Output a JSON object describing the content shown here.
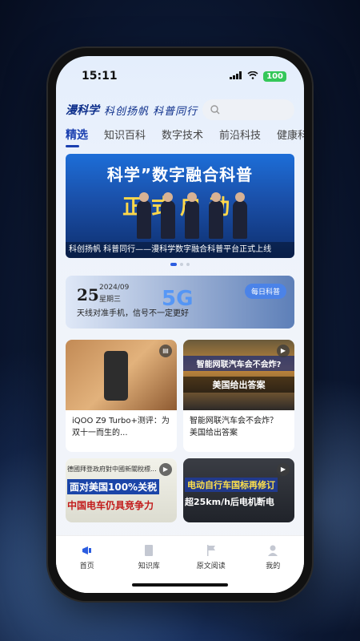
{
  "status": {
    "time": "15:11",
    "battery": "100"
  },
  "header": {
    "logo": "漫科学",
    "slogan": "科创扬帆 科普同行"
  },
  "tabs": [
    "精选",
    "知识百科",
    "数字技术",
    "前沿科技",
    "健康科"
  ],
  "banner": {
    "title": "科学”数字融合科普",
    "subtitle": "正式启动",
    "caption": "科创扬帆 科普同行——漫科学数字融合科普平台正式上线"
  },
  "daily": {
    "day": "25",
    "date": "2024/09",
    "weekday": "星期三",
    "text": "天线对准手机，信号不一定更好",
    "badge": "每日科普",
    "overlay": "5G"
  },
  "cards": [
    {
      "title": "iQOO Z9 Turbo+测评：为双十一而生的...",
      "type": "article"
    },
    {
      "title": "智能网联汽车会不会炸？ 美国给出答案",
      "type": "video",
      "overlay_top": "智能网联汽车会不会炸?",
      "overlay_bottom": "美国给出答案"
    },
    {
      "title": "",
      "type": "video",
      "overlay_l1": "德國拜登政府對中國新關稅標...",
      "overlay_l2": "面对美国100%关税",
      "overlay_l3": "中国电车仍具竞争力"
    },
    {
      "title": "",
      "type": "video",
      "overlay_l1": "电动自行车国标再修订",
      "overlay_l2": "超25km/h后电机断电"
    }
  ],
  "nav": [
    {
      "label": "首页",
      "icon": "megaphone-icon"
    },
    {
      "label": "知识库",
      "icon": "book-icon"
    },
    {
      "label": "原文阅读",
      "icon": "flag-icon"
    },
    {
      "label": "我的",
      "icon": "user-icon"
    }
  ]
}
